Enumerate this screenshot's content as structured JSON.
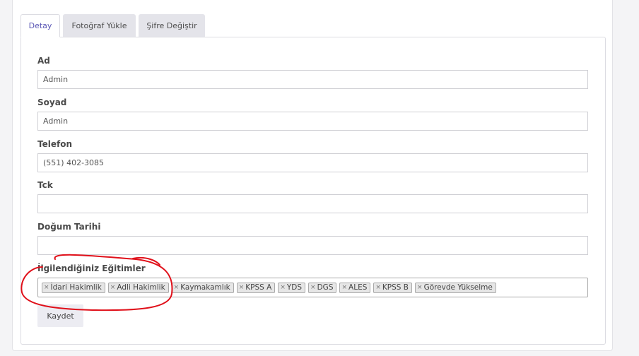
{
  "tabs": [
    {
      "label": "Detay",
      "active": true
    },
    {
      "label": "Fotoğraf Yükle",
      "active": false
    },
    {
      "label": "Şifre Değiştir",
      "active": false
    }
  ],
  "form": {
    "ad": {
      "label": "Ad",
      "value": "Admin"
    },
    "soyad": {
      "label": "Soyad",
      "value": "Admin"
    },
    "telefon": {
      "label": "Telefon",
      "value": "(551) 402-3085"
    },
    "tck": {
      "label": "Tck",
      "value": ""
    },
    "dogum_tarihi": {
      "label": "Doğum Tarihi",
      "value": ""
    },
    "egitimler": {
      "label": "İlgilendiğiniz Eğitimler",
      "remove_symbol": "×",
      "tags": [
        "İdari Hakimlik",
        "Adli Hakimlik",
        "Kaymakamlık",
        "KPSS A",
        "YDS",
        "DGS",
        "ALES",
        "KPSS B",
        "Görevde Yükselme"
      ]
    }
  },
  "save_button": {
    "label": "Kaydet"
  },
  "colors": {
    "active_tab_text": "#5a56b5",
    "annotation": "#e0101a"
  }
}
